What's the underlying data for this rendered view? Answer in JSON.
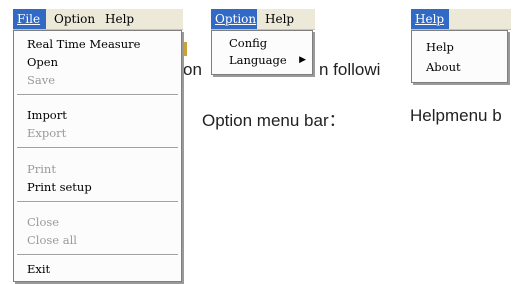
{
  "file_menu": {
    "menubar": [
      "File",
      "Option",
      "Help"
    ],
    "items": [
      {
        "label": "Real Time Measure",
        "enabled": true
      },
      {
        "label": "Open",
        "enabled": true
      },
      {
        "label": "Save",
        "enabled": false
      },
      {
        "label": "Import",
        "enabled": true
      },
      {
        "label": "Export",
        "enabled": false
      },
      {
        "label": "Print",
        "enabled": false
      },
      {
        "label": "Print setup",
        "enabled": true
      },
      {
        "label": "Close",
        "enabled": false
      },
      {
        "label": "Close all",
        "enabled": false
      },
      {
        "label": "Exit",
        "enabled": true
      }
    ]
  },
  "option_menu": {
    "menubar": [
      "Option",
      "Help"
    ],
    "items": [
      {
        "label": "Config"
      },
      {
        "label": "Language",
        "submenu_arrow": "▶"
      }
    ]
  },
  "help_menu": {
    "menubar": [
      "Help"
    ],
    "items": [
      {
        "label": "Help"
      },
      {
        "label": "About"
      }
    ]
  },
  "captions": {
    "behind_fragment_1": "on",
    "behind_fragment_2": "n followi",
    "option_caption": "Option menu bar：",
    "help_caption": "Helpmenu b"
  },
  "colors": {
    "menubar_bg": "#ece9d8",
    "selected_bg": "#316ac5",
    "disabled_text": "#9a9a9a"
  }
}
